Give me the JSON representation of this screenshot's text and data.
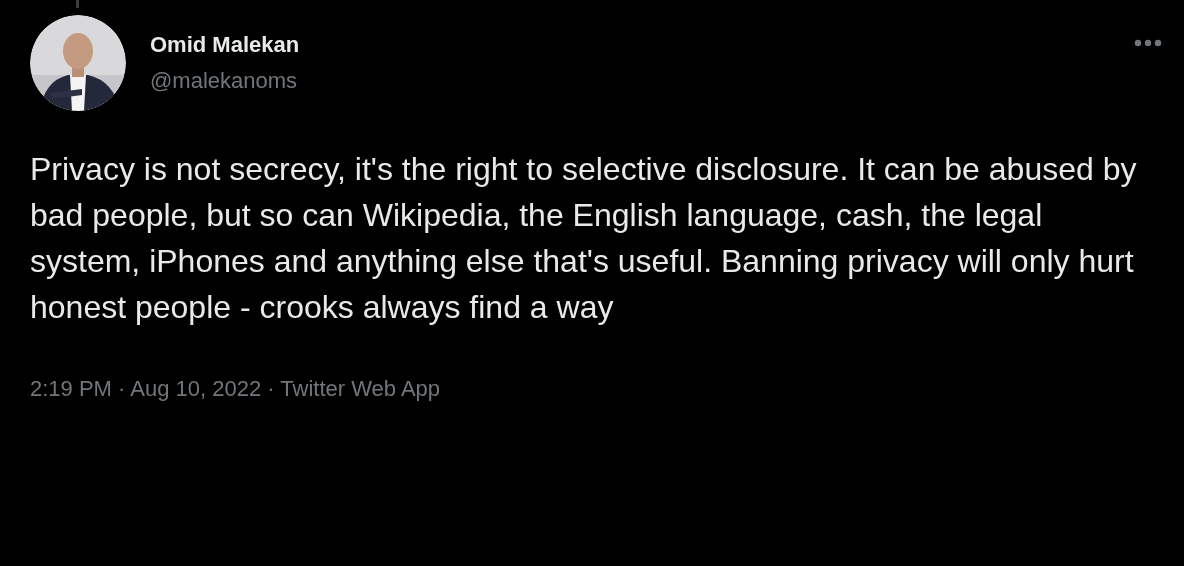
{
  "author": {
    "name": "Omid Malekan",
    "handle": "@malekanoms"
  },
  "text": "Privacy is not secrecy, it's the right to selective disclosure. It can be abused by bad people, but so can Wikipedia, the English language, cash, the legal system, iPhones and anything else that's useful. Banning privacy will only hurt honest people - crooks always find a way",
  "meta": "2:19 PM · Aug 10, 2022 · Twitter Web App"
}
